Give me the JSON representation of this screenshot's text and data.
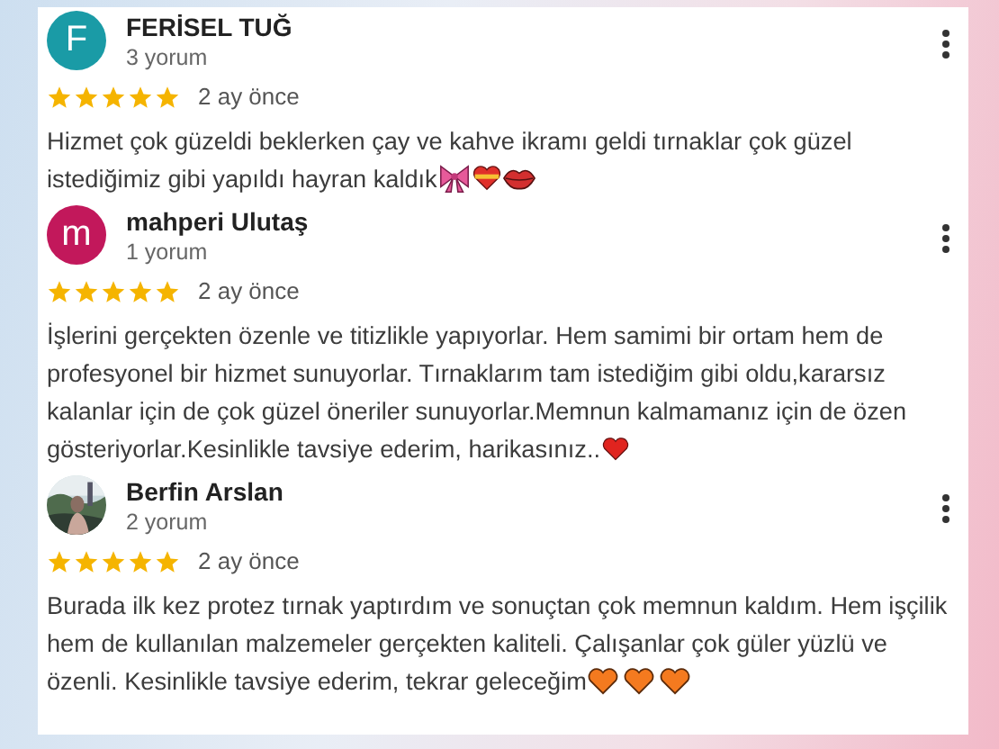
{
  "reviews": [
    {
      "name": "FERİSEL TUĞ",
      "count": "3 yorum",
      "avatar": {
        "kind": "letter",
        "letter": "F",
        "color": "#1a9ba6"
      },
      "stars": 5,
      "time": "2 ay önce",
      "text": "Hizmet çok güzeldi beklerken çay ve kahve ikramı geldi tırnaklar çok güzel istediğimiz gibi yapıldı hayran kaldık",
      "emojis": [
        {
          "kind": "bow"
        },
        {
          "kind": "heart-ribbon"
        },
        {
          "kind": "lips"
        }
      ]
    },
    {
      "name": "mahperi Ulutaş",
      "count": "1 yorum",
      "avatar": {
        "kind": "letter",
        "letter": "m",
        "color": "#c2185b"
      },
      "stars": 5,
      "time": "2 ay önce",
      "text": "İşlerini gerçekten özenle ve titizlikle yapıyorlar. Hem samimi bir ortam hem de profesyonel bir hizmet sunuyorlar. Tırnaklarım tam istediğim gibi oldu,kararsız kalanlar için de çok güzel öneriler sunuyorlar.Memnun kalmamanız için de özen gösteriyorlar.Kesinlikle tavsiye ederim, harikasınız..",
      "emojis": [
        {
          "kind": "red-heart"
        }
      ]
    },
    {
      "name": "Berfin Arslan",
      "count": "2 yorum",
      "stars": 5,
      "time": "2 ay önce",
      "text": "Burada ilk kez protez tırnak yaptırdım ve sonuçtan çok memnun kaldım. Hem işçilik hem de kullanılan malzemeler gerçekten kaliteli. Çalışanlar çok güler yüzlü ve özenli. Kesinlikle tavsiye ederim, tekrar geleceğim",
      "emojis": [
        {
          "kind": "orange-heart"
        },
        {
          "kind": "orange-heart"
        },
        {
          "kind": "orange-heart"
        }
      ]
    }
  ]
}
